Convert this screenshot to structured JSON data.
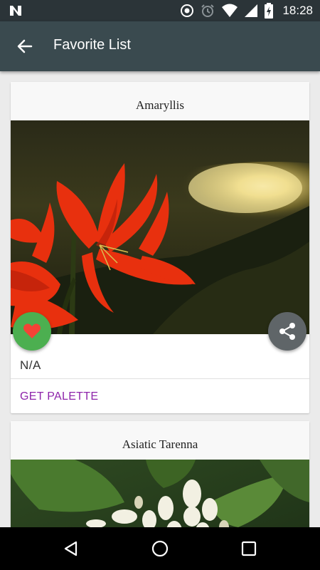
{
  "status_bar": {
    "time": "18:28",
    "icons": [
      "n-logo-icon",
      "data-saver-icon",
      "alarm-icon",
      "wifi-icon",
      "signal-icon",
      "battery-icon"
    ]
  },
  "app_bar": {
    "title": "Favorite List",
    "back_icon": "arrow-left-icon"
  },
  "cards": [
    {
      "name": "Amaryllis",
      "value": "N/A",
      "action_label": "GET PALETTE",
      "favorite_icon": "heart-icon",
      "share_icon": "share-icon"
    },
    {
      "name": "Asiatic Tarenna"
    }
  ],
  "colors": {
    "status_bar": "#2b3438",
    "app_bar": "#3a4a4f",
    "favorite_fab": "#4caf50",
    "share_fab": "#5f6568",
    "action_text": "#8e24aa",
    "background": "#ebebeb"
  },
  "nav_bar": {
    "icons": [
      "back-triangle-icon",
      "home-circle-icon",
      "recents-square-icon"
    ]
  }
}
